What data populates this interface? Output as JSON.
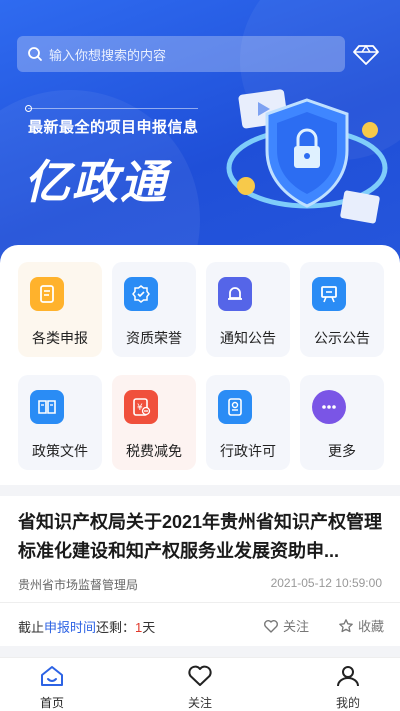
{
  "search": {
    "placeholder": "输入你想搜索的内容",
    "icon": "search-icon"
  },
  "hero": {
    "tagline": "最新最全的项目申报信息",
    "brand": "亿政通"
  },
  "categories": [
    {
      "label": "各类申报",
      "icon": "document-icon",
      "color": "#ffb22c"
    },
    {
      "label": "资质荣誉",
      "icon": "badge-icon",
      "color": "#2a8cf5"
    },
    {
      "label": "通知公告",
      "icon": "bell-icon",
      "color": "#5565e8"
    },
    {
      "label": "公示公告",
      "icon": "board-icon",
      "color": "#2a8cf5"
    },
    {
      "label": "政策文件",
      "icon": "book-icon",
      "color": "#2a8cf5"
    },
    {
      "label": "税费减免",
      "icon": "tax-icon",
      "color": "#f0503c"
    },
    {
      "label": "行政许可",
      "icon": "license-icon",
      "color": "#2a8cf5"
    },
    {
      "label": "更多",
      "icon": "more-icon",
      "color": "#7a55e6"
    }
  ],
  "news": {
    "title": "省知识产权局关于2021年贵州省知识产权管理标准化建设和知产权服务业发展资助申...",
    "source": "贵州省市场监督管理局",
    "date": "2021-05-12  10:59:00",
    "deadline_prefix": "截止",
    "deadline_highlight": "申报时间",
    "deadline_mid": "还剩：",
    "deadline_days": "1",
    "deadline_unit": "天",
    "follow_label": "关注",
    "favorite_label": "收藏"
  },
  "tabs": [
    {
      "label": "首页",
      "icon": "home-icon",
      "active": true
    },
    {
      "label": "关注",
      "icon": "heart-icon",
      "active": false
    },
    {
      "label": "我的",
      "icon": "user-icon",
      "active": false
    }
  ],
  "colors": {
    "brand_blue": "#2f6bf0",
    "accent_blue": "#2d63e4",
    "accent_red": "#e0392b"
  }
}
